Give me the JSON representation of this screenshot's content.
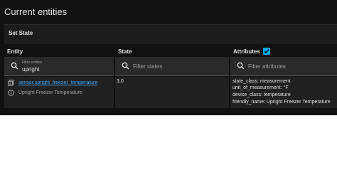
{
  "page_title": "Current entities",
  "set_state_label": "Set State",
  "headers": {
    "entity": "Entity",
    "state": "State",
    "attributes": "Attributes"
  },
  "attributes_checkbox_checked": true,
  "filters": {
    "entities": {
      "label": "Filter entities",
      "value": "upright"
    },
    "states": {
      "placeholder": "Filter states"
    },
    "attributes": {
      "placeholder": "Filter attributes"
    }
  },
  "row": {
    "entity_id": "sensor.upright_freezer_temperature",
    "friendly_name": "Upright Freezer Temperature",
    "state": "3.0",
    "attributes": [
      "state_class: measurement",
      "unit_of_measurement: °F",
      "device_class: temperature",
      "friendly_name: Upright Freezer Temperature"
    ]
  },
  "colors": {
    "background": "#111111",
    "accent": "#03a9f4",
    "link": "#42a5f5"
  }
}
